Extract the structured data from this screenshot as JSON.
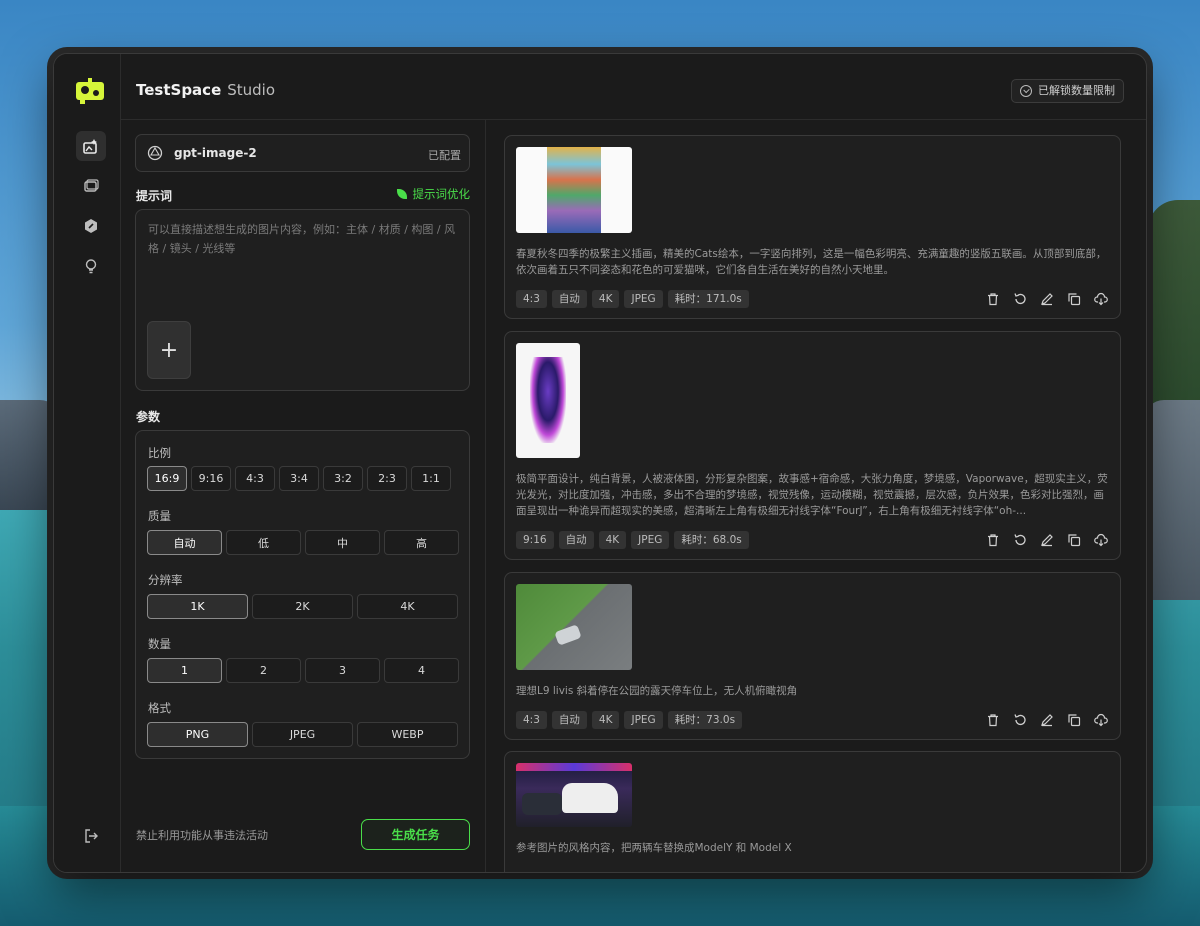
{
  "app": {
    "title": "TestSpace",
    "subtitle": "Studio",
    "unlock_label": "已解锁数量限制"
  },
  "rail": {
    "items": [
      {
        "name": "generate",
        "active": true
      },
      {
        "name": "gallery",
        "active": false
      },
      {
        "name": "models",
        "active": false
      },
      {
        "name": "ideas",
        "active": false
      }
    ]
  },
  "model": {
    "name": "gpt-image-2",
    "status": "已配置"
  },
  "prompt": {
    "label": "提示词",
    "optimize_label": "提示词优化",
    "placeholder": "可以直接描述想生成的图片内容，例如：主体 / 材质 / 构图 / 风格 / 镜头 / 光线等",
    "add_label": "+"
  },
  "params": {
    "label": "参数",
    "ratio": {
      "label": "比例",
      "options": [
        "16:9",
        "9:16",
        "4:3",
        "3:4",
        "3:2",
        "2:3",
        "1:1"
      ],
      "selected": "16:9"
    },
    "quality": {
      "label": "质量",
      "options": [
        "自动",
        "低",
        "中",
        "高"
      ],
      "selected": "自动"
    },
    "resolution": {
      "label": "分辨率",
      "options": [
        "1K",
        "2K",
        "4K"
      ],
      "selected": "1K"
    },
    "count": {
      "label": "数量",
      "options": [
        "1",
        "2",
        "3",
        "4"
      ],
      "selected": "1"
    },
    "format": {
      "label": "格式",
      "options": [
        "PNG",
        "JPEG",
        "WEBP"
      ],
      "selected": "PNG"
    }
  },
  "footer": {
    "disclaimer": "禁止利用功能从事违法活动",
    "generate_label": "生成任务"
  },
  "results": [
    {
      "description": "春夏秋冬四季的极繁主义插画，精美的Cats绘本，一字竖向排列，这是一幅色彩明亮、充满童趣的竖版五联画。从顶部到底部，依次画着五只不同姿态和花色的可爱猫咪，它们各自生活在美好的自然小天地里。",
      "tags": [
        "4:3",
        "自动",
        "4K",
        "JPEG",
        "耗时：171.0s"
      ]
    },
    {
      "description": "极简平面设计，纯白背景，人被液体困，分形复杂图案，故事感+宿命感，大张力角度，梦境感，Vaporwave，超现实主义，荧光发光，对比度加强，冲击感，多出不合理的梦境感，视觉残像，运动模糊，视觉震撼，层次感，负片效果，色彩对比强烈，画面呈现出一种诡异而超现实的美感，超清晰左上角有极细无衬线字体“FourJ”，右上角有极细无衬线字体“oh-...",
      "tags": [
        "9:16",
        "自动",
        "4K",
        "JPEG",
        "耗时：68.0s"
      ]
    },
    {
      "description": "理想L9 livis 斜着停在公园的露天停车位上，无人机俯瞰视角",
      "tags": [
        "4:3",
        "自动",
        "4K",
        "JPEG",
        "耗时：73.0s"
      ]
    },
    {
      "description": "参考图片的风格内容，把两辆车替换成ModelY 和 Model X",
      "tags": []
    }
  ],
  "icons": {
    "card_actions": [
      "trash-icon",
      "retry-icon",
      "edit-icon",
      "copy-icon",
      "download-icon"
    ]
  },
  "colors": {
    "accent": "#4ade4a",
    "background": "#1b1b1b"
  }
}
